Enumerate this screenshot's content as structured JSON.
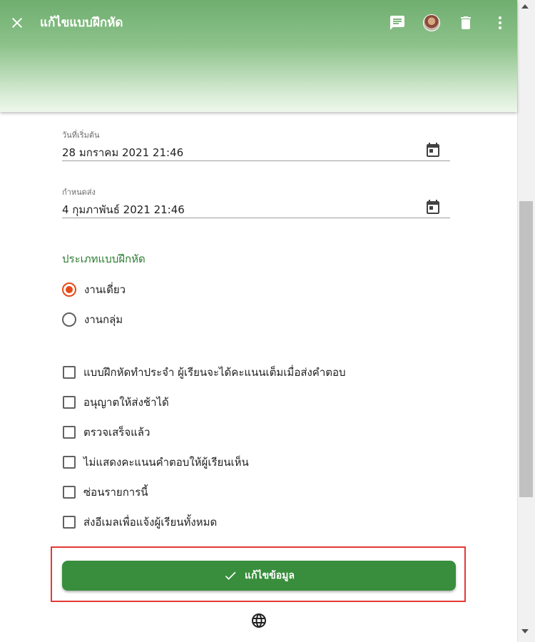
{
  "header": {
    "title": "แก้ไขแบบฝึกหัด",
    "icons": [
      "close-icon",
      "comment-icon",
      "avatar",
      "delete-icon",
      "more-vert-icon"
    ]
  },
  "start_date": {
    "label": "วันที่เริ่มต้น",
    "value": "28 มกราคม 2021 21:46"
  },
  "due_date": {
    "label": "กำหนดส่ง",
    "value": "4 กุมภาพันธ์ 2021 21:46"
  },
  "exercise_type": {
    "title": "ประเภทแบบฝึกหัด",
    "options": [
      {
        "label": "งานเดี่ยว",
        "selected": true
      },
      {
        "label": "งานกลุ่ม",
        "selected": false
      }
    ]
  },
  "options": [
    {
      "label": "แบบฝึกหัดทำประจำ ผู้เรียนจะได้คะแนนเต็มเมื่อส่งคำตอบ",
      "checked": false
    },
    {
      "label": "อนุญาตให้ส่งช้าได้",
      "checked": false
    },
    {
      "label": "ตรวจเสร็จแล้ว",
      "checked": false
    },
    {
      "label": "ไม่แสดงคะแนนคำตอบให้ผู้เรียนเห็น",
      "checked": false
    },
    {
      "label": "ซ่อนรายการนี้",
      "checked": false
    },
    {
      "label": "ส่งอีเมลเพื่อแจ้งผู้เรียนทั้งหมด",
      "checked": false
    }
  ],
  "save_button": {
    "label": "แก้ไขข้อมูล",
    "icon": "check-icon"
  },
  "footer": {
    "icon": "globe-icon"
  },
  "colors": {
    "primary": "#388e3c",
    "accent_radio": "#e64a19",
    "section_title": "#2e7d32",
    "highlight_border": "#e53935"
  }
}
